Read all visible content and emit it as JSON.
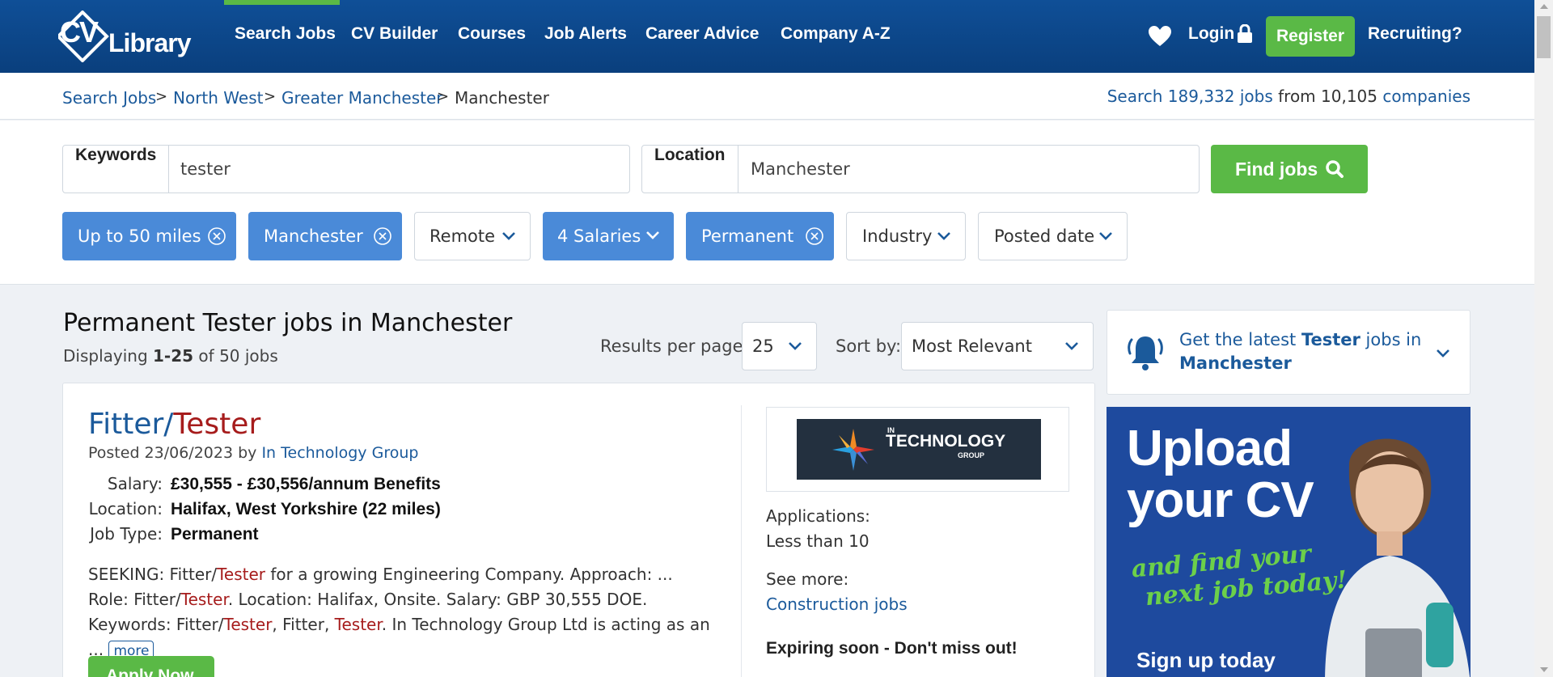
{
  "brand": {
    "logo_cv": "CV",
    "logo_library": "Library"
  },
  "nav": {
    "items": [
      "Search Jobs",
      "CV Builder",
      "Courses",
      "Job Alerts",
      "Career Advice",
      "Company A-Z"
    ],
    "login": "Login",
    "register": "Register",
    "recruiting": "Recruiting?"
  },
  "breadcrumb": [
    "Search Jobs",
    "North West",
    "Greater Manchester",
    "Manchester"
  ],
  "search_count": {
    "pre": "Search ",
    "jobs": "189,332 jobs",
    "mid": " from 10,105 ",
    "companies": "companies"
  },
  "search": {
    "keywords_label": "Keywords",
    "keywords_value": "tester",
    "location_label": "Location",
    "location_value": "Manchester",
    "find_button": "Find jobs"
  },
  "filters": [
    {
      "label": "Up to 50 miles",
      "active": true
    },
    {
      "label": "Manchester",
      "active": true
    },
    {
      "label": "Remote",
      "active": false
    },
    {
      "label": "4 Salaries",
      "active": true
    },
    {
      "label": "Permanent",
      "active": true
    },
    {
      "label": "Industry",
      "active": false
    },
    {
      "label": "Posted date",
      "active": false
    }
  ],
  "results": {
    "title": "Permanent Tester jobs in Manchester",
    "displaying_pre": "Displaying ",
    "displaying_range": "1-25",
    "displaying_post": " of 50 jobs",
    "rpp_label": "Results per page:",
    "rpp_value": "25",
    "sort_label": "Sort by:",
    "sort_value": "Most Relevant"
  },
  "alert": {
    "pre": "Get the latest ",
    "keyword": "Tester",
    "mid": " jobs in ",
    "location": "Manchester"
  },
  "job": {
    "title_pre": "Fitter/",
    "title_hl": "Tester",
    "posted_pre": "Posted 23/06/2023 by ",
    "company": "In Technology Group",
    "salary_label": "Salary:",
    "salary": "£30,555 - £30,556/annum Benefits",
    "location_label": "Location:",
    "location": "Halifax, West Yorkshire (22 miles)",
    "type_label": "Job Type:",
    "type": "Permanent",
    "desc": {
      "p1": "SEEKING: Fitter/",
      "h1": "Tester",
      "p2": " for a growing Engineering Company. Approach: ... Role: Fitter/",
      "h2": "Tester",
      "p3": ". Location: Halifax, Onsite. Salary: GBP 30,555 DOE. Keywords: Fitter/",
      "h3": "Tester",
      "p4": ", Fitter, ",
      "h4": "Tester",
      "p5": ". In Technology Group Ltd is acting as an ..."
    },
    "more": "more",
    "apply": "Apply Now",
    "company_logo": {
      "small": "IN",
      "name": "TECHNOLOGY",
      "sub": "GROUP"
    },
    "applications_label": "Applications:",
    "applications_value": "Less than 10",
    "see_more_label": "See more:",
    "see_more_link": "Construction jobs",
    "expiring": "Expiring soon - Don't miss out!"
  },
  "banner": {
    "line1": "Upload",
    "line2": "your CV",
    "script1": "and find your",
    "script2": "next job today!",
    "cta": "Sign up today"
  },
  "colors": {
    "navy": "#0a3f7d",
    "green": "#5ab946",
    "chip_blue": "#4a8ad8",
    "link": "#1b5a9b",
    "highlight": "#a61c1c"
  }
}
